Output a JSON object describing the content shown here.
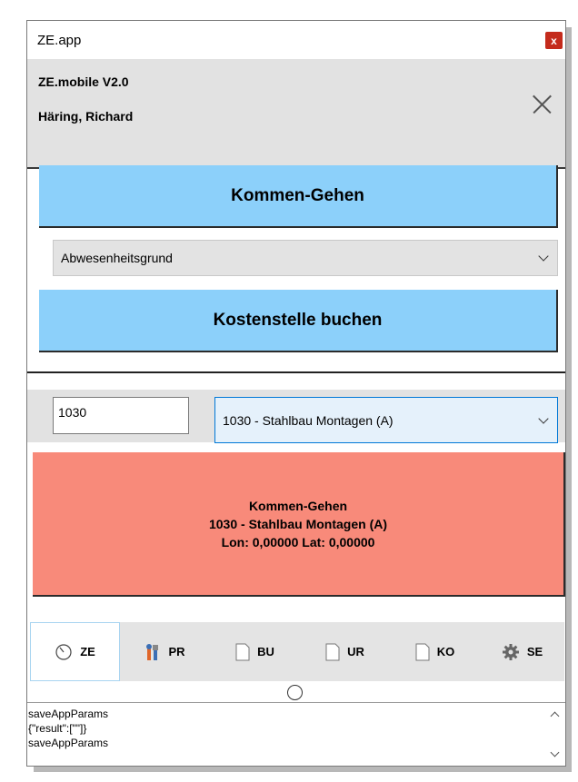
{
  "window": {
    "title": "ZE.app",
    "close_glyph": "x"
  },
  "header": {
    "app_version": "ZE.mobile V2.0",
    "user": "Häring, Richard"
  },
  "buttons": {
    "kommen_gehen": "Kommen-Gehen",
    "kostenstelle": "Kostenstelle buchen"
  },
  "absence_select": {
    "value": "Abwesenheitsgrund"
  },
  "cost_center": {
    "input_value": "1030",
    "selected": "1030 - Stahlbau Montagen (A)"
  },
  "status": {
    "line1": "Kommen-Gehen",
    "line2": "1030 - Stahlbau Montagen (A)",
    "line3": "Lon: 0,00000 Lat: 0,00000",
    "color": "#f88a7a"
  },
  "tabs": [
    {
      "label": "ZE",
      "icon": "clock-icon"
    },
    {
      "label": "PR",
      "icon": "tools-icon"
    },
    {
      "label": "BU",
      "icon": "page-icon"
    },
    {
      "label": "UR",
      "icon": "page-icon"
    },
    {
      "label": "KO",
      "icon": "page-icon"
    },
    {
      "label": "SE",
      "icon": "gear-icon"
    }
  ],
  "log": {
    "lines": [
      "saveAppParams",
      "{\"result\":[\"\"]}",
      "saveAppParams"
    ]
  },
  "colors": {
    "button_blue": "#8cd0fa",
    "header_gray": "#e2e2e2",
    "close_red": "#c42b1c"
  }
}
